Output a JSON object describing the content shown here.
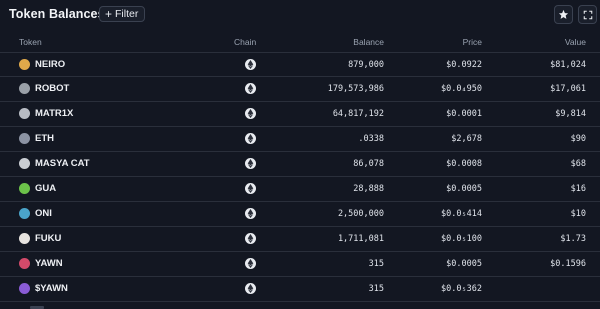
{
  "header": {
    "title": "Token Balances",
    "filter_label": "Filter"
  },
  "columns": {
    "token": "Token",
    "chain": "Chain",
    "balance": "Balance",
    "price": "Price",
    "value": "Value"
  },
  "rows": [
    {
      "token": "NEIRO",
      "icon": "neiro-logo-icon",
      "icon_color": "#e0a94a",
      "chain": "ethereum",
      "balance": "879,000",
      "price": "$0.0922",
      "value": "$81,024"
    },
    {
      "token": "ROBOT",
      "icon": "robot-logo-icon",
      "icon_color": "#9aa0a8",
      "chain": "ethereum",
      "balance": "179,573,986",
      "price": "$0.0₄950",
      "value": "$17,061"
    },
    {
      "token": "MATR1X",
      "icon": "matr1x-logo-icon",
      "icon_color": "#b8bcc4",
      "chain": "ethereum",
      "balance": "64,817,192",
      "price": "$0.0001",
      "value": "$9,814"
    },
    {
      "token": "ETH",
      "icon": "eth-logo-icon",
      "icon_color": "#8c93a3",
      "chain": "ethereum",
      "balance": ".0338",
      "price": "$2,678",
      "value": "$90"
    },
    {
      "token": "MASYA CAT",
      "icon": "masya-cat-logo-icon",
      "icon_color": "#c9cdd3",
      "chain": "ethereum",
      "balance": "86,078",
      "price": "$0.0008",
      "value": "$68"
    },
    {
      "token": "GUA",
      "icon": "gua-logo-icon",
      "icon_color": "#6cc24a",
      "chain": "ethereum",
      "balance": "28,888",
      "price": "$0.0005",
      "value": "$16"
    },
    {
      "token": "ONI",
      "icon": "oni-logo-icon",
      "icon_color": "#4aa3c9",
      "chain": "ethereum",
      "balance": "2,500,000",
      "price": "$0.0₅414",
      "value": "$10"
    },
    {
      "token": "FUKU",
      "icon": "fuku-logo-icon",
      "icon_color": "#e7e3df",
      "chain": "ethereum",
      "balance": "1,711,081",
      "price": "$0.0₅100",
      "value": "$1.73"
    },
    {
      "token": "YAWN",
      "icon": "yawn-logo-icon",
      "icon_color": "#d24a6a",
      "chain": "ethereum",
      "balance": "315",
      "price": "$0.0005",
      "value": "$0.1596"
    },
    {
      "token": "$YAWN",
      "icon": "syawn-logo-icon",
      "icon_color": "#8a5cd6",
      "chain": "ethereum",
      "balance": "315",
      "price": "$0.0₅362",
      "value": ""
    }
  ]
}
